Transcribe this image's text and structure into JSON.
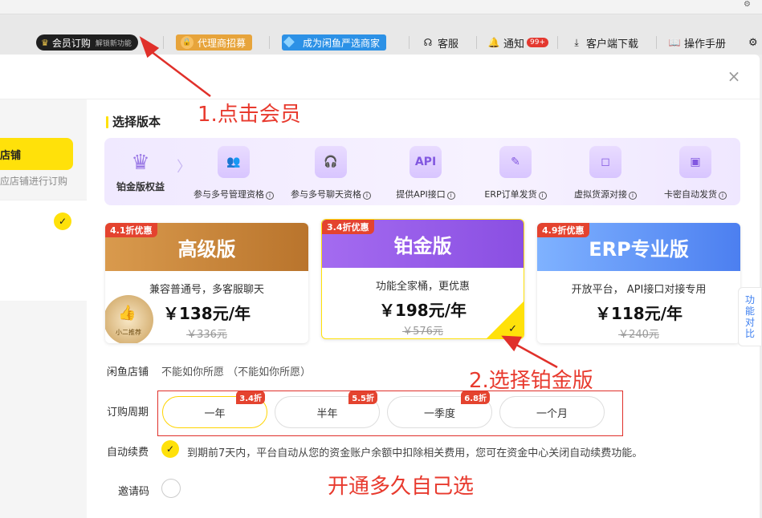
{
  "topbar": {
    "corner_icon": "⚙"
  },
  "nav": {
    "member_label": "会员订购",
    "member_sub": "解锁新功能",
    "agent_label": "代理商招募",
    "select_label": "成为闲鱼严选商家",
    "service_label": "客服",
    "notice_label": "通知",
    "notice_badge": "99+",
    "client_label": "客户端下载",
    "manual_label": "操作手册",
    "more_icon": "⚙"
  },
  "modal": {
    "close_icon": "×"
  },
  "left": {
    "shop_label": "店铺",
    "shop_hint": "应店铺进行订购",
    "check": "✓"
  },
  "section_title": "选择版本",
  "perks": {
    "head_label": "铂金版权益",
    "items": [
      {
        "icon": "user-group-icon",
        "glyph": "👥",
        "label": "参与多号管理资格"
      },
      {
        "icon": "headset-icon",
        "glyph": "🎧",
        "label": "参与多号聊天资格"
      },
      {
        "icon": "api-icon",
        "glyph": "API",
        "label": "提供API接口"
      },
      {
        "icon": "order-icon",
        "glyph": "✎",
        "label": "ERP订单发货"
      },
      {
        "icon": "bag-icon",
        "glyph": "◻",
        "label": "虚拟货源对接"
      },
      {
        "icon": "card-icon",
        "glyph": "▣",
        "label": "卡密自动发货"
      }
    ],
    "info_glyph": "i"
  },
  "plans": [
    {
      "discount": "4.1折优惠",
      "name": "高级版",
      "desc": "兼容普通号，多客服聊天",
      "price": "￥138元/年",
      "orig": "￥336元",
      "seal_text": "小二推荐"
    },
    {
      "discount": "3.4折优惠",
      "name": "铂金版",
      "desc": "功能全家桶，更优惠",
      "price": "￥198元/年",
      "orig": "￥576元"
    },
    {
      "discount": "4.9折优惠",
      "name": "ERP专业版",
      "desc": "开放平台， API接口对接专用",
      "price": "￥118元/年",
      "orig": "￥240元"
    }
  ],
  "side_tab": {
    "line1": "功",
    "line2": "能",
    "line3": "对",
    "line4": "比"
  },
  "form": {
    "shop_label": "闲鱼店铺",
    "shop_value": "不能如你所愿 （不能如你所愿）",
    "period_label": "订购周期",
    "periods": [
      {
        "label": "一年",
        "tag": "3.4折"
      },
      {
        "label": "半年",
        "tag": "5.5折"
      },
      {
        "label": "一季度",
        "tag": "6.8折"
      },
      {
        "label": "一个月",
        "tag": ""
      }
    ],
    "auto_label": "自动续费",
    "auto_text": "到期前7天内，平台自动从您的资金账户余额中扣除相关费用，您可在资金中心关闭自动续费功能。",
    "invite_label": "邀请码"
  },
  "annotations": {
    "a1": "1.点击会员",
    "a2": "2.选择铂金版",
    "a3": "开通多久自己选"
  },
  "colors": {
    "accent_yellow": "#ffe10a",
    "annotation_red": "#e83a2e"
  }
}
